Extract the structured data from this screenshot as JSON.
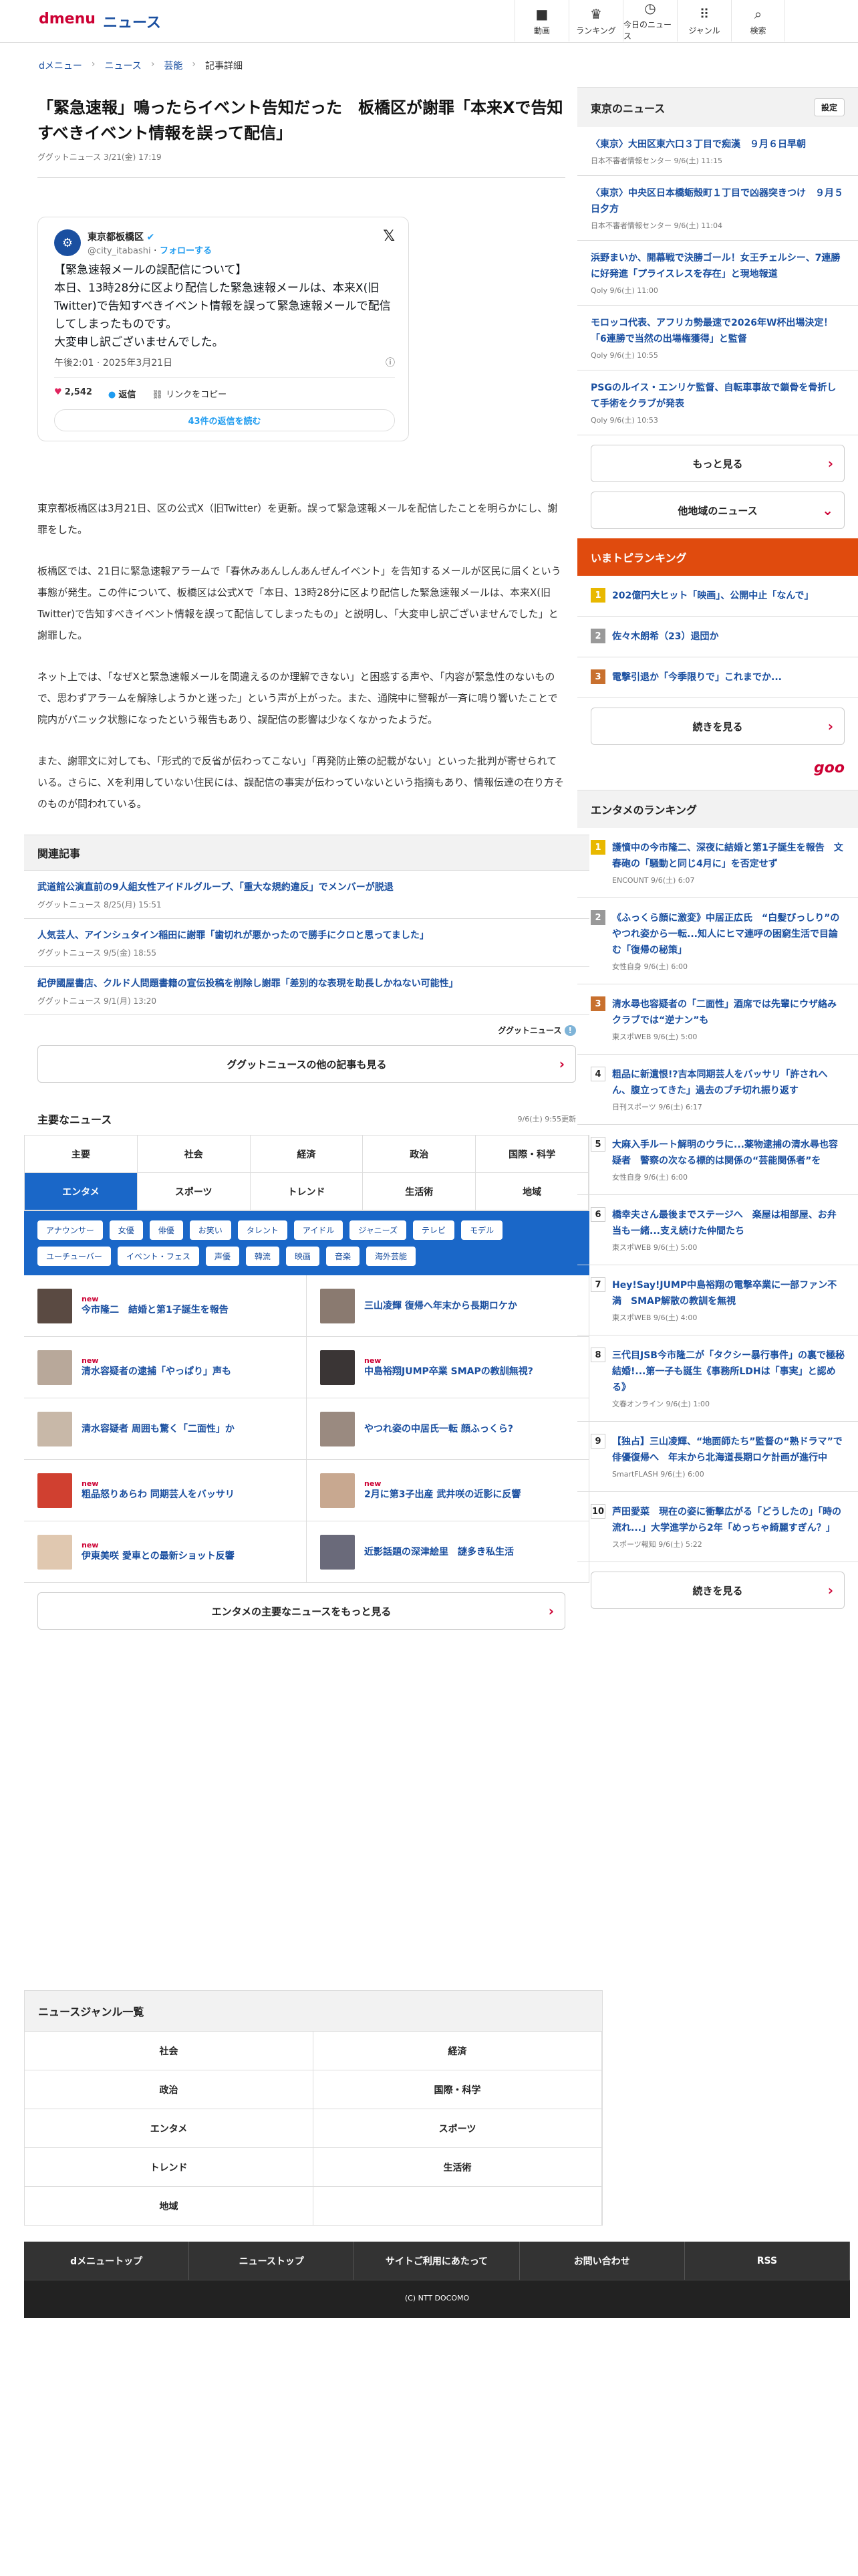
{
  "header": {
    "logo": "dmenu",
    "logo_sub": "ニュース",
    "nav": [
      {
        "icon": "video-icon",
        "glyph": "■",
        "label": "動画"
      },
      {
        "icon": "trophy-icon",
        "glyph": "♛",
        "label": "ランキング"
      },
      {
        "icon": "clock-icon",
        "glyph": "◷",
        "label": "今日のニュース"
      },
      {
        "icon": "grid-icon",
        "glyph": "⠿",
        "label": "ジャンル"
      },
      {
        "icon": "search-icon",
        "glyph": "⌕",
        "label": "検索"
      }
    ]
  },
  "breadcrumb": [
    "dメニュー",
    "ニュース",
    "芸能",
    "記事詳細"
  ],
  "article": {
    "title": "「緊急速報」鳴ったらイベント告知だった　板橋区が謝罪「本来Xで告知すべきイベント情報を誤って配信」",
    "meta": "ググットニュース 3/21(金) 17:19",
    "tweet": {
      "name": "東京都板橋区",
      "handle": "@city_itabashi",
      "follow": "フォローする",
      "body": "【緊急速報メールの誤配信について】\n本日、13時28分に区より配信した緊急速報メールは、本来X(旧Twitter)で告知すべきイベント情報を誤って緊急速報メールで配信してしまったものです。\n大変申し訳ございませんでした。",
      "time": "午後2:01 · 2025年3月21日",
      "likes": "2,542",
      "reply": "返信",
      "copy": "リンクをコピー",
      "read_replies": "43件の返信を読む"
    },
    "paragraphs": [
      "東京都板橋区は3月21日、区の公式X（旧Twitter）を更新。誤って緊急速報メールを配信したことを明らかにし、謝罪をした。",
      "板橋区では、21日に緊急速報アラームで「春休みあんしんあんぜんイベント」を告知するメールが区民に届くという事態が発生。この件について、板橋区は公式Xで「本日、13時28分に区より配信した緊急速報メールは、本来X(旧Twitter)で告知すべきイベント情報を誤って配信してしまったもの」と説明し、「大変申し訳ございませんでした」と謝罪した。",
      "ネット上では、「なぜXと緊急速報メールを間違えるのか理解できない」と困惑する声や、「内容が緊急性のないもので、思わずアラームを解除しようかと迷った」という声が上がった。また、通院中に警報が一斉に鳴り響いたことで院内がパニック状態になったという報告もあり、誤配信の影響は少なくなかったようだ。",
      "また、謝罪文に対しても、「形式的で反省が伝わってこない」「再発防止策の記載がない」といった批判が寄せられている。さらに、Xを利用していない住民には、誤配信の事実が伝わっていないという指摘もあり、情報伝達の在り方そのものが問われている。"
    ]
  },
  "related": {
    "heading": "関連記事",
    "items": [
      {
        "title": "武道館公演直前の9人組女性アイドルグループ、「重大な規約違反」でメンバーが脱退",
        "meta": "ググットニュース 8/25(月) 15:51"
      },
      {
        "title": "人気芸人、アインシュタイン稲田に謝罪「歯切れが悪かったので勝手にクロと思ってました」",
        "meta": "ググットニュース 9/5(金) 18:55"
      },
      {
        "title": "紀伊國屋書店、クルド人問題書籍の宣伝投稿を削除し謝罪「差別的な表現を助長しかねない可能性」",
        "meta": "ググットニュース 9/1(月) 13:20"
      }
    ],
    "brand": "ググットニュース",
    "more": "ググットニュースの他の記事も見る"
  },
  "major": {
    "heading": "主要なニュース",
    "updated": "9/6(土) 9:55更新",
    "tabs": [
      "主要",
      "社会",
      "経済",
      "政治",
      "国際・科学",
      "エンタメ",
      "スポーツ",
      "トレンド",
      "生活術",
      "地域"
    ],
    "tags": [
      "アナウンサー",
      "女優",
      "俳優",
      "お笑い",
      "タレント",
      "アイドル",
      "ジャニーズ",
      "テレビ",
      "モデル",
      "ユーチューバー",
      "イベント・フェス",
      "声優",
      "韓流",
      "映画",
      "音楽",
      "海外芸能"
    ],
    "news": [
      {
        "title": "今市隆二　結婚と第1子誕生を報告",
        "new": "new"
      },
      {
        "title": "三山凌輝 復帰へ年末から長期ロケか",
        "new": ""
      },
      {
        "title": "清水容疑者の逮捕「やっぱり」声も",
        "new": "new"
      },
      {
        "title": "中島裕翔JUMP卒業 SMAPの教訓無視?",
        "new": "new"
      },
      {
        "title": "清水容疑者 周囲も驚く「二面性」か",
        "new": ""
      },
      {
        "title": "やつれ姿の中居氏一転 顔ふっくら?",
        "new": ""
      },
      {
        "title": "粗品怒りあらわ 同期芸人をバッサリ",
        "new": "new"
      },
      {
        "title": "2月に第3子出産 武井咲の近影に反響",
        "new": "new"
      },
      {
        "title": "伊東美咲 愛車との最新ショット反響",
        "new": "new"
      },
      {
        "title": "近影話題の深津絵里　謎多き私生活",
        "new": ""
      }
    ],
    "more": "エンタメの主要なニュースをもっと見る"
  },
  "side": {
    "tokyo_heading": "東京のニュース",
    "settings": "設定",
    "tokyo": [
      {
        "title": "〈東京〉大田区東六口３丁目で痴漢　９月６日早朝",
        "meta": "日本不審者情報センター 9/6(土) 11:15"
      },
      {
        "title": "〈東京〉中央区日本橋蛎殻町１丁目で凶器突きつけ　９月５日夕方",
        "meta": "日本不審者情報センター 9/6(土) 11:04"
      },
      {
        "title": "浜野まいか、開幕戦で決勝ゴール！女王チェルシー、7連勝に好発進「プライスレスを存在」と現地報道",
        "meta": "Qoly 9/6(土) 11:00"
      },
      {
        "title": "モロッコ代表、アフリカ勢最速で2026年W杯出場決定！「6連勝で当然の出場権獲得」と監督",
        "meta": "Qoly 9/6(土) 10:55"
      },
      {
        "title": "PSGのルイス・エンリケ監督、自転車事故で鎖骨を骨折して手術をクラブが発表",
        "meta": "Qoly 9/6(土) 10:53"
      }
    ],
    "tokyo_more": "もっと見る",
    "other_area": "他地域のニュース",
    "now_rank_heading": "いまトピランキング",
    "now_rank": [
      "202億円大ヒット「映画」、公開中止「なんで」",
      "佐々木朗希（23）退団か",
      "電撃引退か「今季限りで」これまでか..."
    ],
    "now_more": "続きを見る",
    "powered": "goo",
    "ent_heading": "エンタメのランキング",
    "ent_rank": [
      {
        "title": "護憤中の今市隆二、深夜に結婚と第1子誕生を報告　文春砲の「騒動と同じ4月に」を否定せず",
        "meta": "ENCOUNT 9/6(土) 6:07"
      },
      {
        "title": "《ふっくら顔に激変》中居正広氏　“白髪びっしり”のやつれ姿から一転...知人にヒマ連呼の困窮生活で目論む「復帰の秘策」",
        "meta": "女性自身 9/6(土) 6:00"
      },
      {
        "title": "清水尋也容疑者の「二面性」酒席では先輩にウザ絡み　クラブでは“逆ナン”も",
        "meta": "東スポWEB 9/6(土) 5:00"
      },
      {
        "title": "粗品に新遺恨!?吉本同期芸人をバッサリ「許されへん、腹立ってきた」過去のブチ切れ振り返す",
        "meta": "日刊スポーツ 9/6(土) 6:17"
      },
      {
        "title": "大麻入手ルート解明のウラに...薬物逮捕の清水尋也容疑者　警察の次なる標的は関係の“芸能関係者”を",
        "meta": "女性自身 9/6(土) 6:00"
      },
      {
        "title": "橋幸夫さん最後までステージへ　楽屋は相部屋、お弁当も一緒...支え続けた仲間たち",
        "meta": "東スポWEB 9/6(土) 5:00"
      },
      {
        "title": "Hey!Say!JUMP中島裕翔の電撃卒業に一部ファン不満　SMAP解散の教訓を無視",
        "meta": "東スポWEB 9/6(土) 4:00"
      },
      {
        "title": "三代目JSB今市隆二が「タクシー暴行事件」の裏で極秘結婚!...第一子も誕生《事務所LDHは「事実」と認める》",
        "meta": "文春オンライン 9/6(土) 1:00"
      },
      {
        "title": "【独占】三山凌輝、“地面師たち”監督の“熟ドラマ”で俳優復帰へ　年末から北海道長期ロケ計画が進行中",
        "meta": "SmartFLASH 9/6(土) 6:00"
      },
      {
        "title": "芦田愛菜　現在の姿に衝撃広がる「どうしたの」「時の流れ...」大学進学から2年「めっちゃ綺麗すぎん？」",
        "meta": "スポーツ報知 9/6(土) 5:22"
      }
    ],
    "ent_more": "続きを見る"
  },
  "genre": {
    "heading": "ニュースジャンル一覧",
    "items": [
      "社会",
      "経済",
      "政治",
      "国際・科学",
      "エンタメ",
      "スポーツ",
      "トレンド",
      "生活術",
      "地域"
    ]
  },
  "footer": {
    "links": [
      "dメニュートップ",
      "ニューストップ",
      "サイトご利用にあたって",
      "お問い合わせ",
      "RSS"
    ],
    "copyright": "(C) NTT DOCOMO"
  }
}
